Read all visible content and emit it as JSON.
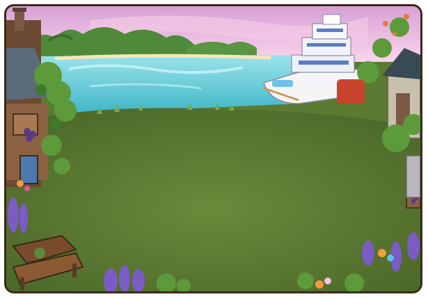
{
  "scene": {
    "palette": {
      "sky_top": "#e9b7e0",
      "sky_bottom": "#f8d7ef",
      "water": "#6fd1dc",
      "water_light": "#a7e9ee",
      "lawn": "#5b7a32",
      "lawn_dark": "#46622a",
      "frame": "#3a2a1a",
      "treeline": "#4f8a3b",
      "lavender": "#7b5bc4"
    },
    "elements": {
      "sky": "sunset-sky",
      "far-shore": "treeline",
      "lake": "lake",
      "yacht": "cruise-ship",
      "left-building": "winery-house",
      "right-building": "stone-silo",
      "bench": "wooden-bench",
      "flowers": "lavender-and-lilies",
      "grapes": "grape-sign"
    }
  }
}
